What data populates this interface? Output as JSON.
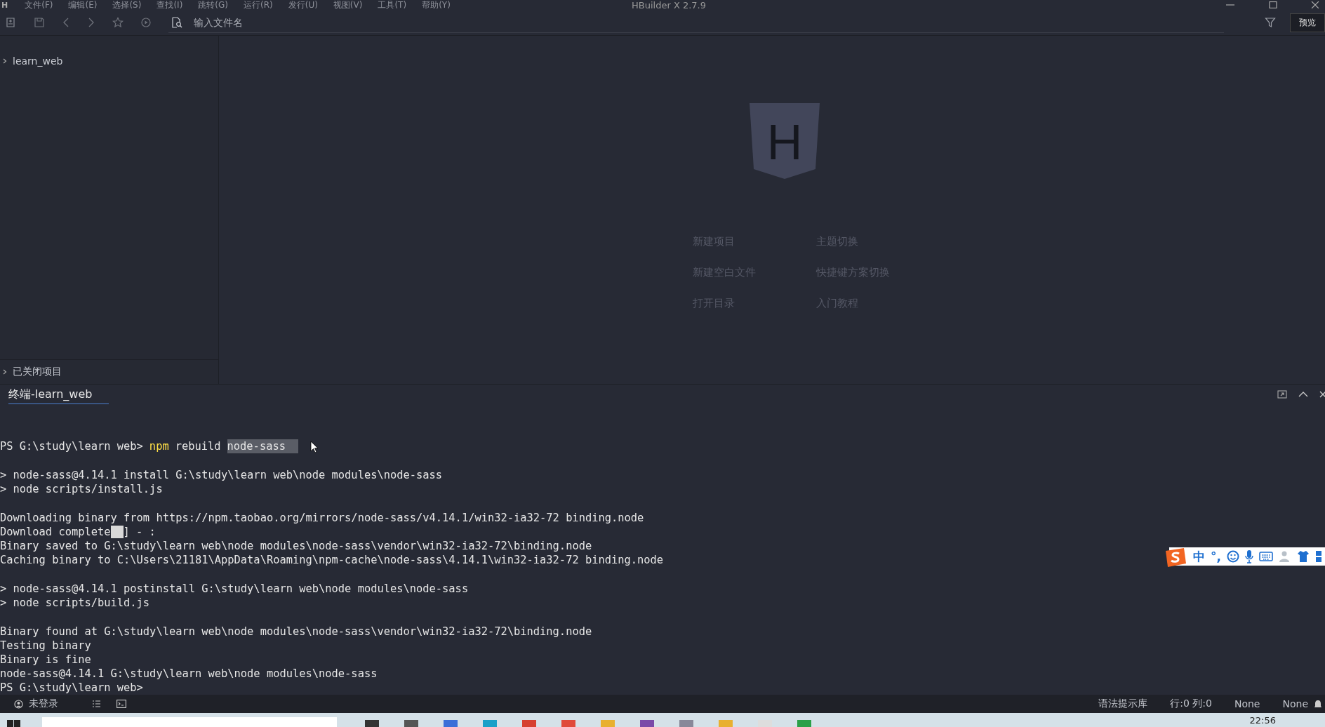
{
  "window": {
    "app_mark": "H",
    "menu": [
      "文件(F)",
      "编辑(E)",
      "选择(S)",
      "查找(I)",
      "跳转(G)",
      "运行(R)",
      "发行(U)",
      "视图(V)",
      "工具(T)",
      "帮助(Y)"
    ],
    "title": "HBuilder X 2.7.9"
  },
  "toolbar": {
    "file_search": {
      "placeholder": "输入文件名"
    },
    "preview_button": "预览"
  },
  "sidebar": {
    "projects": [
      {
        "label": "learn_web",
        "expanded": false
      }
    ],
    "closed_projects": {
      "label": "已关闭项目",
      "expanded": false
    }
  },
  "welcome": {
    "logo_letter": "H",
    "links": [
      "新建项目",
      "主题切换",
      "新建空白文件",
      "快捷键方案切换",
      "打开目录",
      "入门教程"
    ]
  },
  "terminal": {
    "tabs": [
      {
        "label": "终端-learn_web",
        "selected": true
      }
    ],
    "lines": [
      {
        "kind": "command",
        "gap_before": true,
        "prompt": "PS G:\\study\\learn web>",
        "command": "npm",
        "args": "rebuild",
        "selection": "node-sass"
      },
      {
        "kind": "text",
        "gap_before": true,
        "text": "> node-sass@4.14.1 install G:\\study\\learn web\\node modules\\node-sass"
      },
      {
        "kind": "text",
        "gap_before": false,
        "text": "> node scripts/install.js"
      },
      {
        "kind": "text",
        "gap_before": true,
        "text": "Downloading binary from https://npm.taobao.org/mirrors/node-sass/v4.14.1/win32-ia32-72 binding.node"
      },
      {
        "kind": "progress",
        "gap_before": false,
        "text": "Download complete",
        "tail": "] - :"
      },
      {
        "kind": "text",
        "gap_before": false,
        "text": "Binary saved to G:\\study\\learn web\\node modules\\node-sass\\vendor\\win32-ia32-72\\binding.node"
      },
      {
        "kind": "text",
        "gap_before": false,
        "text": "Caching binary to C:\\Users\\21181\\AppData\\Roaming\\npm-cache\\node-sass\\4.14.1\\win32-ia32-72 binding.node"
      },
      {
        "kind": "text",
        "gap_before": true,
        "text": "> node-sass@4.14.1 postinstall G:\\study\\learn web\\node modules\\node-sass"
      },
      {
        "kind": "text",
        "gap_before": false,
        "text": "> node scripts/build.js"
      },
      {
        "kind": "text",
        "gap_before": true,
        "text": "Binary found at G:\\study\\learn web\\node modules\\node-sass\\vendor\\win32-ia32-72\\binding.node"
      },
      {
        "kind": "text",
        "gap_before": false,
        "text": "Testing binary"
      },
      {
        "kind": "text",
        "gap_before": false,
        "text": "Binary is fine"
      },
      {
        "kind": "text",
        "gap_before": false,
        "text": "node-sass@4.14.1 G:\\study\\learn web\\node modules\\node-sass"
      },
      {
        "kind": "prompt",
        "gap_before": false,
        "text": "PS G:\\study\\learn web>"
      }
    ]
  },
  "ime_toolbar": {
    "mode": "中",
    "punctuation": "°,"
  },
  "status_bar": {
    "account": "未登录",
    "syntax_library": "语法提示库",
    "position": "行:0  列:0",
    "encoding": "None",
    "language": "None"
  },
  "taskbar": {
    "clock": "22:56"
  }
}
